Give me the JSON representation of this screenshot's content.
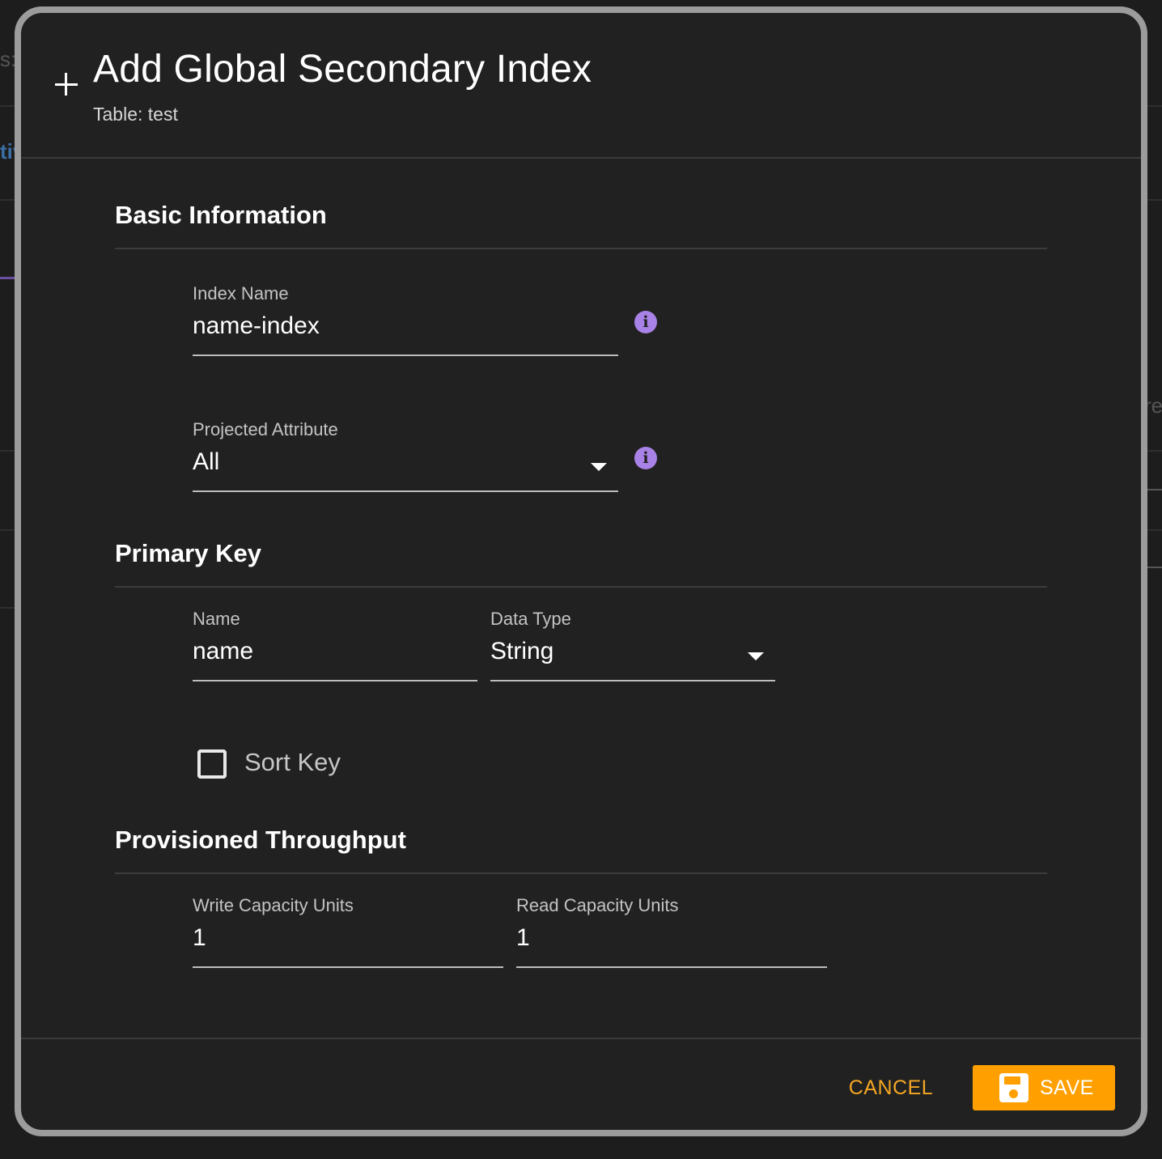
{
  "background": {
    "frag_left_top": "s:",
    "frag_left_blue": "tiv",
    "frag_right": "re"
  },
  "dialog": {
    "title": "Add Global Secondary Index",
    "subtitle": "Table: test"
  },
  "basic_info": {
    "section_title": "Basic Information",
    "index_name": {
      "label": "Index Name",
      "value": "name-index"
    },
    "projected_attribute": {
      "label": "Projected Attribute",
      "value": "All"
    }
  },
  "primary_key": {
    "section_title": "Primary Key",
    "name": {
      "label": "Name",
      "value": "name"
    },
    "data_type": {
      "label": "Data Type",
      "value": "String"
    },
    "sort_key_label": "Sort Key",
    "sort_key_checked": false
  },
  "throughput": {
    "section_title": "Provisioned Throughput",
    "write": {
      "label": "Write Capacity Units",
      "value": "1"
    },
    "read": {
      "label": "Read Capacity Units",
      "value": "1"
    }
  },
  "actions": {
    "cancel_label": "CANCEL",
    "save_label": "SAVE"
  },
  "colors": {
    "accent": "#ffa000",
    "info": "#a882e6",
    "surface": "#212121"
  }
}
